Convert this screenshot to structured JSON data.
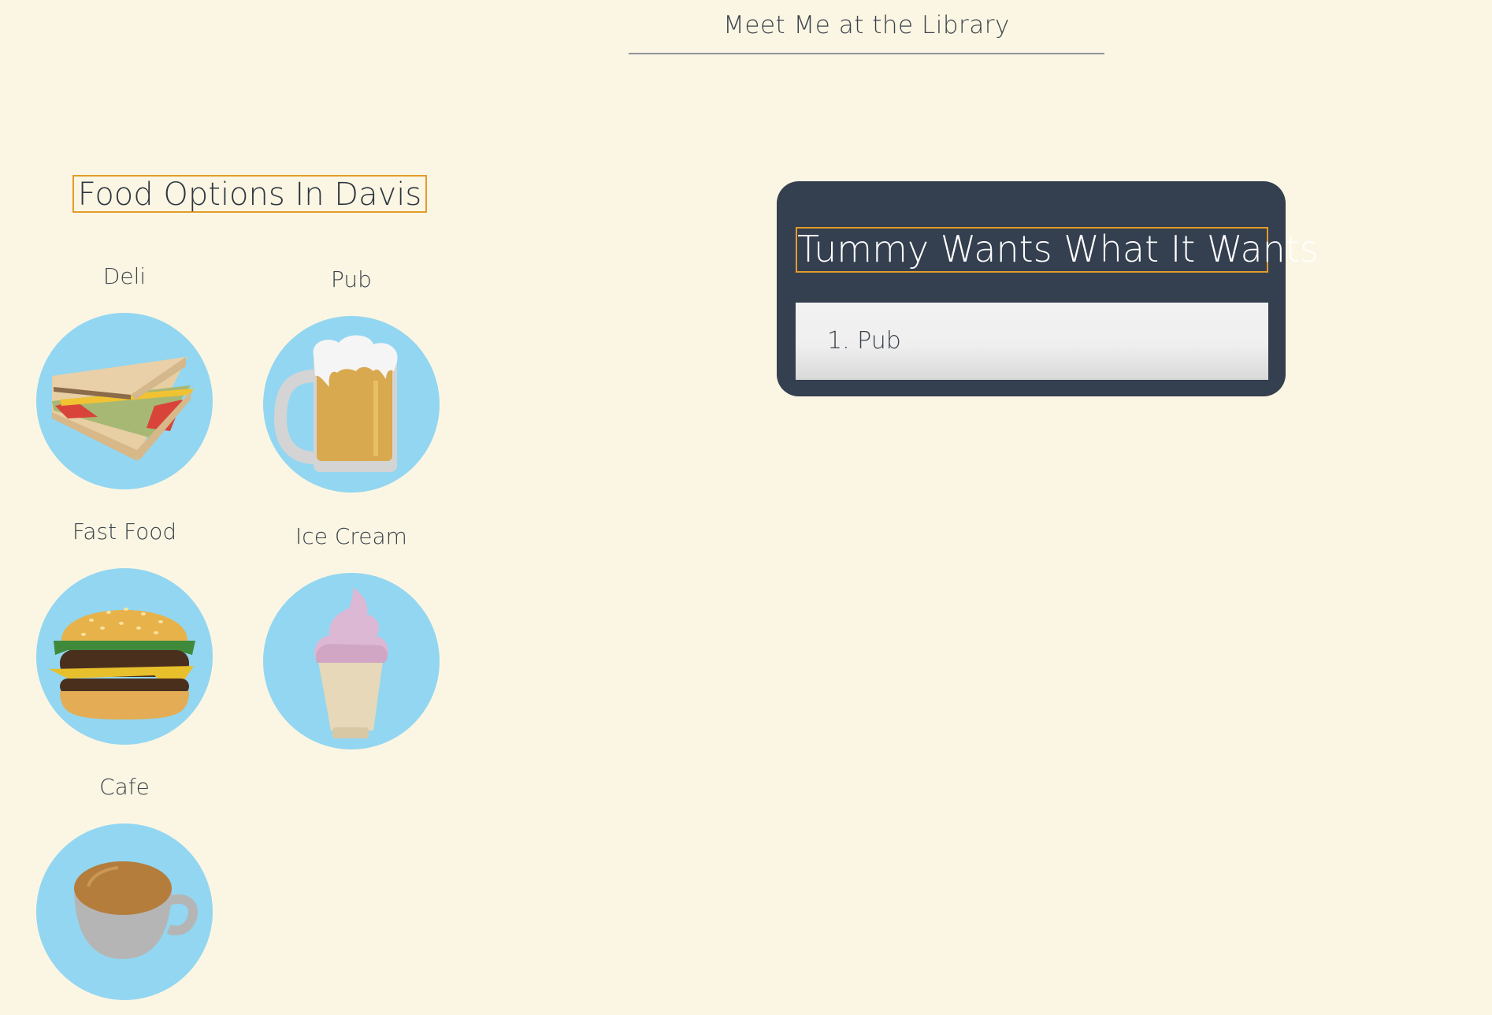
{
  "header": {
    "title": "Meet Me at the Library"
  },
  "food_section": {
    "heading": "Food Options In Davis",
    "items": [
      {
        "label": "Deli",
        "icon": "sandwich-icon"
      },
      {
        "label": "Pub",
        "icon": "beer-mug-icon"
      },
      {
        "label": "Fast Food",
        "icon": "burger-icon"
      },
      {
        "label": "Ice Cream",
        "icon": "ice-cream-cone-icon"
      },
      {
        "label": "Cafe",
        "icon": "coffee-cup-icon"
      }
    ]
  },
  "selection_panel": {
    "heading": "Tummy Wants What It Wants",
    "choice": "1. Pub"
  },
  "colors": {
    "background": "#fbf6e3",
    "accent_border": "#e39c2a",
    "panel": "#343f4f",
    "icon_circle": "#93d6f1"
  }
}
